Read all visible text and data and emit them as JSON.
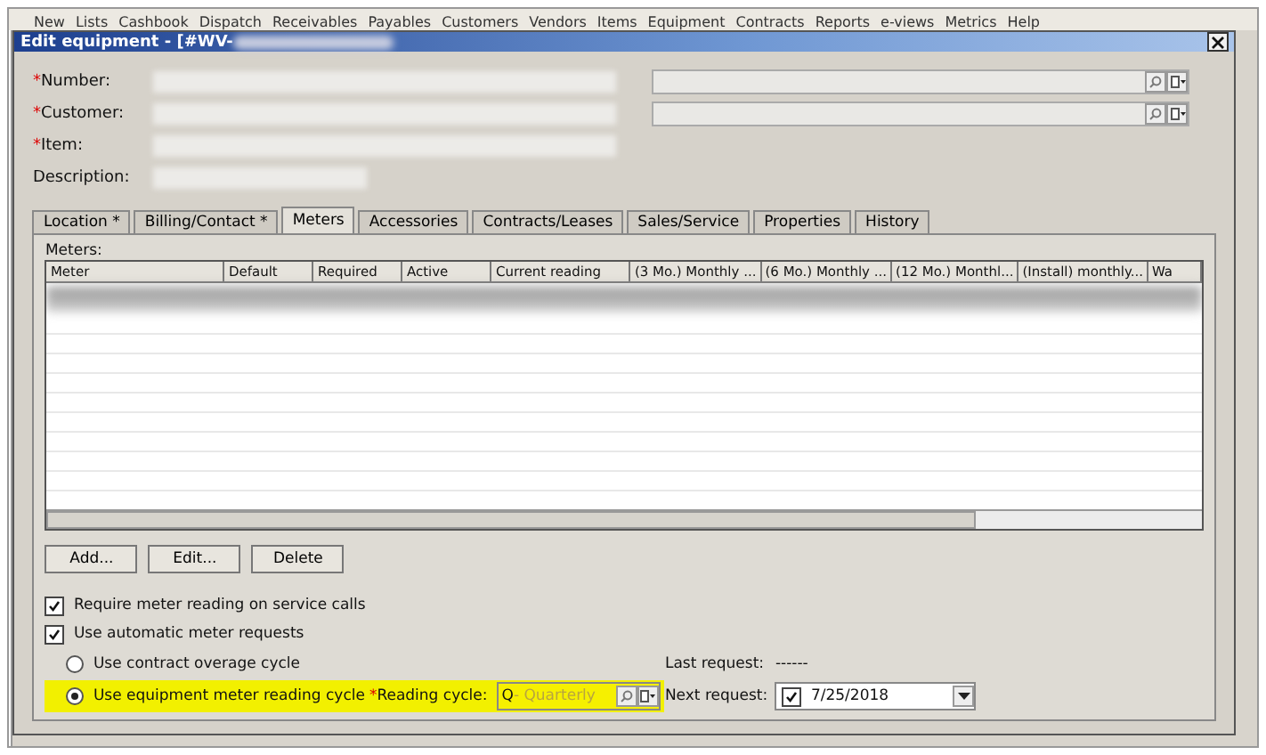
{
  "toolbar": [
    "New",
    "Lists",
    "Cashbook",
    "Dispatch",
    "Receivables",
    "Payables",
    "Customers",
    "Vendors",
    "Items",
    "Equipment",
    "Contracts",
    "Reports",
    "e-views",
    "Metrics",
    "Help"
  ],
  "window": {
    "title": "Edit equipment - [#WV-"
  },
  "fields": [
    {
      "label": "Number:",
      "marker": "*"
    },
    {
      "label": "Customer:",
      "marker": "*"
    },
    {
      "label": "Item:",
      "marker": "*"
    },
    {
      "label": "Description:"
    }
  ],
  "tabs": [
    {
      "label": "Location *",
      "selected": false
    },
    {
      "label": "Billing/Contact *",
      "selected": false
    },
    {
      "label": "Meters",
      "selected": true
    },
    {
      "label": "Accessories",
      "selected": false
    },
    {
      "label": "Contracts/Leases",
      "selected": false
    },
    {
      "label": "Sales/Service",
      "selected": false
    },
    {
      "label": "Properties",
      "selected": false
    },
    {
      "label": "History",
      "selected": false
    }
  ],
  "meters": {
    "label": "Meters:",
    "columns": [
      "Meter",
      "Default",
      "Required",
      "Active",
      "Current reading",
      "(3 Mo.) Monthly ...",
      "(6 Mo.) Monthly ...",
      "(12 Mo.) Monthl...",
      "(Install) monthly...",
      "Wa"
    ]
  },
  "buttons": [
    "Add...",
    "Edit...",
    "Delete"
  ],
  "checks": [
    {
      "label": "Require meter reading on service calls",
      "checked": true
    },
    {
      "label": "Use automatic meter requests",
      "checked": true
    }
  ],
  "radios": [
    {
      "label": "Use contract overage cycle",
      "selected": false
    },
    {
      "label": "Use equipment meter reading cycle",
      "selected": true
    }
  ],
  "reading_cycle": {
    "marker": "*",
    "label": "Reading cycle:",
    "code": "Q",
    "value": " - Quarterly"
  },
  "last_request": {
    "label": "Last request:",
    "value": "------"
  },
  "next_request": {
    "label": "Next request:",
    "checked": true,
    "value": "7/25/2018"
  }
}
